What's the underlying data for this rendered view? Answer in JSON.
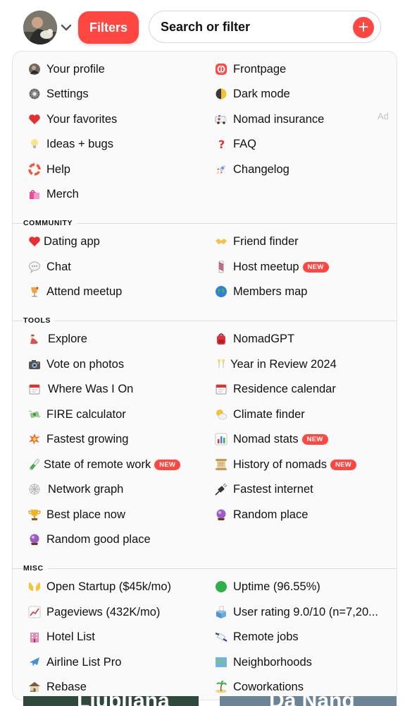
{
  "header": {
    "filters_label": "Filters",
    "search_label": "Search or filter",
    "add_symbol": "+",
    "accent_color": "#ff4742"
  },
  "ad_label": "Ad",
  "menu": {
    "main": [
      {
        "label": "Your profile",
        "icon": "avatar-icon"
      },
      {
        "label": "Frontpage",
        "icon": "frontpage-icon"
      },
      {
        "label": "Settings",
        "icon": "gear-icon"
      },
      {
        "label": "Dark mode",
        "icon": "half-moon-icon"
      },
      {
        "label": "Your favorites",
        "icon": "heart-icon"
      },
      {
        "label": "Nomad insurance",
        "icon": "ambulance-icon"
      },
      {
        "label": "Ideas + bugs",
        "icon": "lightbulb-icon"
      },
      {
        "label": "FAQ",
        "icon": "question-mark-icon"
      },
      {
        "label": "Help",
        "icon": "life-ring-icon"
      },
      {
        "label": "Changelog",
        "icon": "rocket-icon"
      },
      {
        "label": "Merch",
        "icon": "shopping-bags-icon"
      }
    ],
    "community": {
      "title": "COMMUNITY",
      "items": [
        {
          "label": "Dating app",
          "icon": "heart-icon"
        },
        {
          "label": "Friend finder",
          "icon": "handshake-icon"
        },
        {
          "label": "Chat",
          "icon": "speech-bubble-icon"
        },
        {
          "label": "Host meetup",
          "icon": "barber-pole-icon",
          "badge": "NEW"
        },
        {
          "label": "Attend meetup",
          "icon": "cocktail-icon"
        },
        {
          "label": "Members map",
          "icon": "globe-icon"
        }
      ]
    },
    "tools": {
      "title": "TOOLS",
      "items": [
        {
          "label": "Explore",
          "icon": "explorer-icon"
        },
        {
          "label": "NomadGPT",
          "icon": "backpack-icon"
        },
        {
          "label": "Vote on photos",
          "icon": "camera-icon"
        },
        {
          "label": "Year in Review 2024",
          "icon": "champagne-icon"
        },
        {
          "label": "Where Was I On",
          "icon": "calendar-icon"
        },
        {
          "label": "Residence calendar",
          "icon": "calendar-icon"
        },
        {
          "label": "FIRE calculator",
          "icon": "money-wings-icon"
        },
        {
          "label": "Climate finder",
          "icon": "sun-cloud-icon"
        },
        {
          "label": "Fastest growing",
          "icon": "collision-icon"
        },
        {
          "label": "Nomad stats",
          "icon": "bar-chart-icon",
          "badge": "NEW"
        },
        {
          "label": "State of remote work",
          "icon": "test-tube-icon",
          "badge": "NEW"
        },
        {
          "label": "History of nomads",
          "icon": "scroll-icon",
          "badge": "NEW"
        },
        {
          "label": "Network graph",
          "icon": "cobweb-icon"
        },
        {
          "label": "Fastest internet",
          "icon": "plug-icon"
        },
        {
          "label": "Best place now",
          "icon": "trophy-icon"
        },
        {
          "label": "Random place",
          "icon": "crystal-ball-icon"
        },
        {
          "label": "Random good place",
          "icon": "crystal-ball-icon"
        }
      ]
    },
    "misc": {
      "title": "MISC",
      "items": [
        {
          "label": "Open Startup ($45k/mo)",
          "icon": "open-hands-icon"
        },
        {
          "label": "Uptime (96.55%)",
          "icon": "green-circle-icon"
        },
        {
          "label": "Pageviews (432K/mo)",
          "icon": "chart-increasing-icon"
        },
        {
          "label": "User rating 9.0/10 (n=7,20...",
          "icon": "ballot-box-icon"
        },
        {
          "label": "Hotel List",
          "icon": "hotel-icon"
        },
        {
          "label": "Remote jobs",
          "icon": "flying-money-icon"
        },
        {
          "label": "Airline List Pro",
          "icon": "airplane-icon"
        },
        {
          "label": "Neighborhoods",
          "icon": "map-icon"
        },
        {
          "label": "Rebase",
          "icon": "house-icon"
        },
        {
          "label": "Coworkations",
          "icon": "island-icon"
        }
      ]
    }
  },
  "background_cards": [
    "Ljubljana",
    "Da Nang"
  ]
}
